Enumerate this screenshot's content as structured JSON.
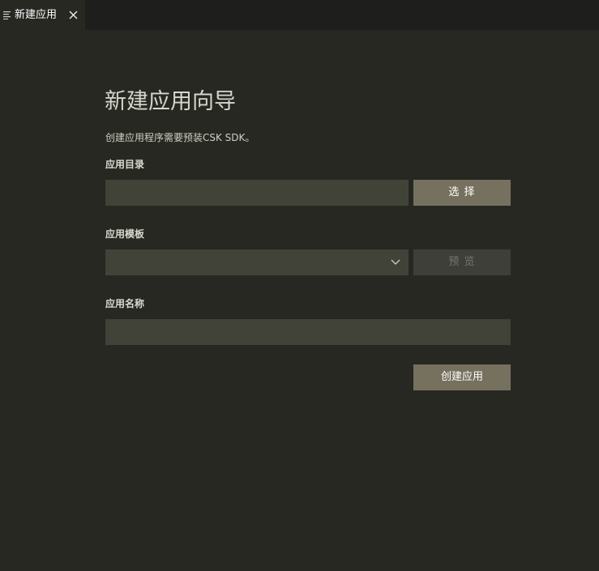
{
  "tab": {
    "label": "新建应用",
    "icon": "preview-lines-icon",
    "close_icon": "close-icon"
  },
  "wizard": {
    "title": "新建应用向导",
    "description": "创建应用程序需要预装CSK SDK。",
    "app_dir": {
      "label": "应用目录",
      "value": "",
      "placeholder": "",
      "choose_button": "选 择"
    },
    "app_template": {
      "label": "应用模板",
      "selected": "",
      "preview_button": "预 览",
      "preview_disabled": true
    },
    "app_name": {
      "label": "应用名称",
      "value": "",
      "placeholder": ""
    },
    "create_button": "创建应用"
  },
  "colors": {
    "background": "#272822",
    "tabbar": "#1e1f1c",
    "input_bg": "#414339",
    "button_bg": "#75715e",
    "button_disabled_bg": "#3e3f38"
  }
}
